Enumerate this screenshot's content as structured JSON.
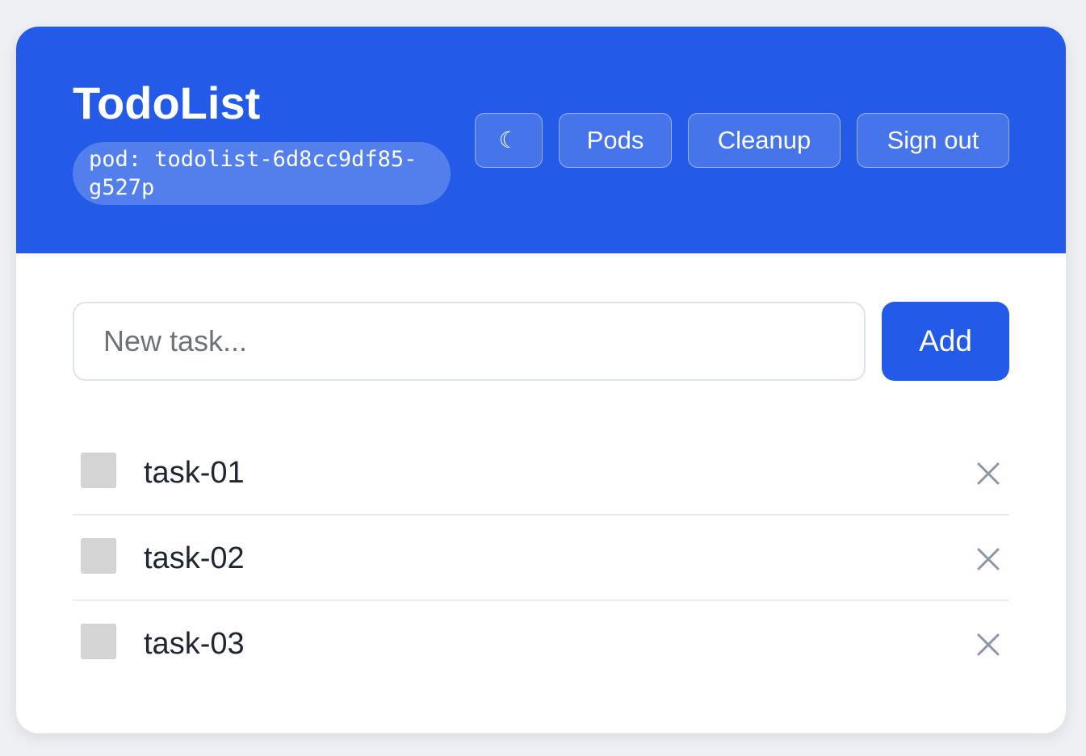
{
  "header": {
    "title": "TodoList",
    "pod_label": "pod: todolist-6d8cc9df85-g527p",
    "buttons": {
      "theme_icon": "☾",
      "pods": "Pods",
      "cleanup": "Cleanup",
      "sign_out": "Sign out"
    }
  },
  "form": {
    "placeholder": "New task...",
    "value": "",
    "add_label": "Add"
  },
  "tasks": [
    {
      "label": "task-01",
      "done": false
    },
    {
      "label": "task-02",
      "done": false
    },
    {
      "label": "task-03",
      "done": false
    }
  ],
  "icons": {
    "theme": "moon-icon",
    "delete": "close-icon"
  },
  "colors": {
    "accent": "#235be8",
    "page_bg": "#eef0f4",
    "card_bg": "#ffffff",
    "checkbox": "#d5d5d5",
    "delete_icon": "#8a96a8",
    "task_text": "#1e2533"
  }
}
